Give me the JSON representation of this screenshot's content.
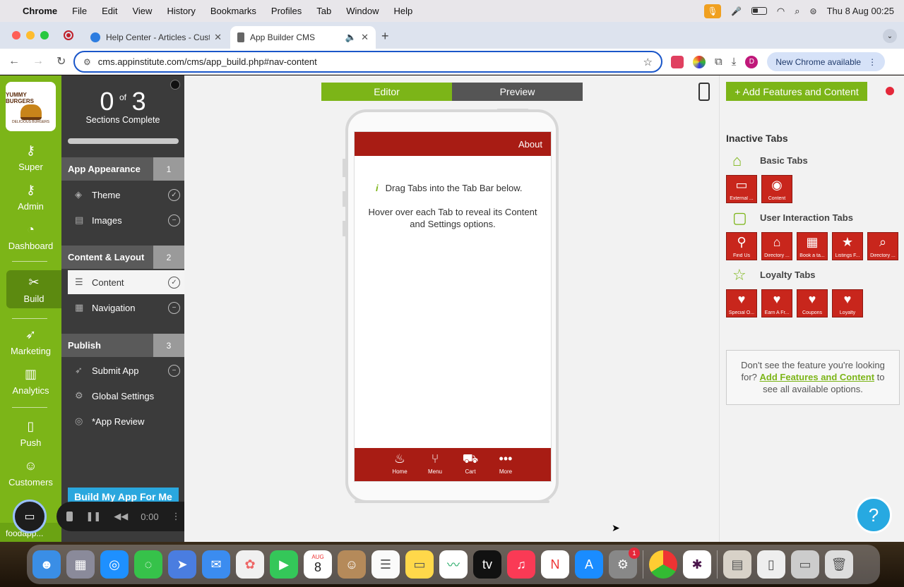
{
  "menubar": {
    "app": "Chrome",
    "items": [
      "File",
      "Edit",
      "View",
      "History",
      "Bookmarks",
      "Profiles",
      "Tab",
      "Window",
      "Help"
    ],
    "clock": "Thu 8 Aug  00:25"
  },
  "tabs": [
    {
      "title": "Help Center - Articles - Custo"
    },
    {
      "title": "App Builder CMS"
    }
  ],
  "toolbar": {
    "url": "cms.appinstitute.com/cms/app_build.php#nav-content",
    "update_label": "New Chrome available",
    "profile_initial": "D"
  },
  "leftnav": {
    "logo_text": "YUMMY BURGERS",
    "logo_sub": "DELICIOUS BURGERS",
    "items": [
      {
        "label": "Super",
        "icon": "key-icon"
      },
      {
        "label": "Admin",
        "icon": "key-icon"
      },
      {
        "label": "Dashboard",
        "icon": "gauge-icon"
      },
      {
        "label": "Build",
        "icon": "tools-icon"
      },
      {
        "label": "Marketing",
        "icon": "rocket-icon"
      },
      {
        "label": "Analytics",
        "icon": "chart-icon"
      },
      {
        "label": "Push",
        "icon": "phone-icon"
      },
      {
        "label": "Customers",
        "icon": "user-icon"
      }
    ],
    "footer": "foodapp..."
  },
  "sections": {
    "done": "0",
    "of": "of",
    "total": "3",
    "subtitle": "Sections Complete",
    "progress": 0,
    "groups": [
      {
        "title": "App Appearance",
        "num": "1",
        "items": [
          {
            "label": "Theme",
            "status": "done"
          },
          {
            "label": "Images",
            "status": "pending"
          }
        ]
      },
      {
        "title": "Content & Layout",
        "num": "2",
        "items": [
          {
            "label": "Content",
            "status": "done"
          },
          {
            "label": "Navigation",
            "status": "pending"
          }
        ]
      },
      {
        "title": "Publish",
        "num": "3",
        "items": [
          {
            "label": "Submit App",
            "status": "pending"
          },
          {
            "label": "Global Settings",
            "status": "none"
          },
          {
            "label": "*App Review",
            "status": "none"
          }
        ]
      }
    ],
    "build_button": "Build My App For Me"
  },
  "recorder": {
    "time": "0:00"
  },
  "canvas": {
    "editor_label": "Editor",
    "preview_label": "Preview",
    "app_header": "About",
    "info_text": "Drag Tabs into the Tab Bar below.",
    "hover_text": "Hover over each Tab to reveal its Content and Settings options.",
    "tabbar": [
      {
        "label": "Home",
        "icon": "bowl-icon"
      },
      {
        "label": "Menu",
        "icon": "cutlery-icon"
      },
      {
        "label": "Cart",
        "icon": "cart-icon"
      },
      {
        "label": "More",
        "icon": "more-icon"
      }
    ]
  },
  "rightpanel": {
    "add_button": "+ Add Features and Content",
    "inactive_title": "Inactive Tabs",
    "groups": [
      {
        "title": "Basic Tabs",
        "tiles": [
          "External ...",
          "Content"
        ]
      },
      {
        "title": "User Interaction Tabs",
        "tiles": [
          "Find Us",
          "Directory ...",
          "Book a ta...",
          "Listings F...",
          "Directory ..."
        ]
      },
      {
        "title": "Loyalty Tabs",
        "tiles": [
          "Special O...",
          "Earn A Fr...",
          "Coupons",
          "Loyalty"
        ]
      }
    ],
    "missing_pre": "Don't see the feature you're looking for?",
    "missing_link": "Add Features and Content",
    "missing_post": "to see all available options."
  },
  "dock": {
    "calendar_month": "AUG",
    "calendar_day": "8",
    "settings_badge": "1"
  },
  "colors": {
    "brand_green": "#7cb518",
    "app_red": "#a81c14",
    "help_blue": "#27a9e1"
  }
}
